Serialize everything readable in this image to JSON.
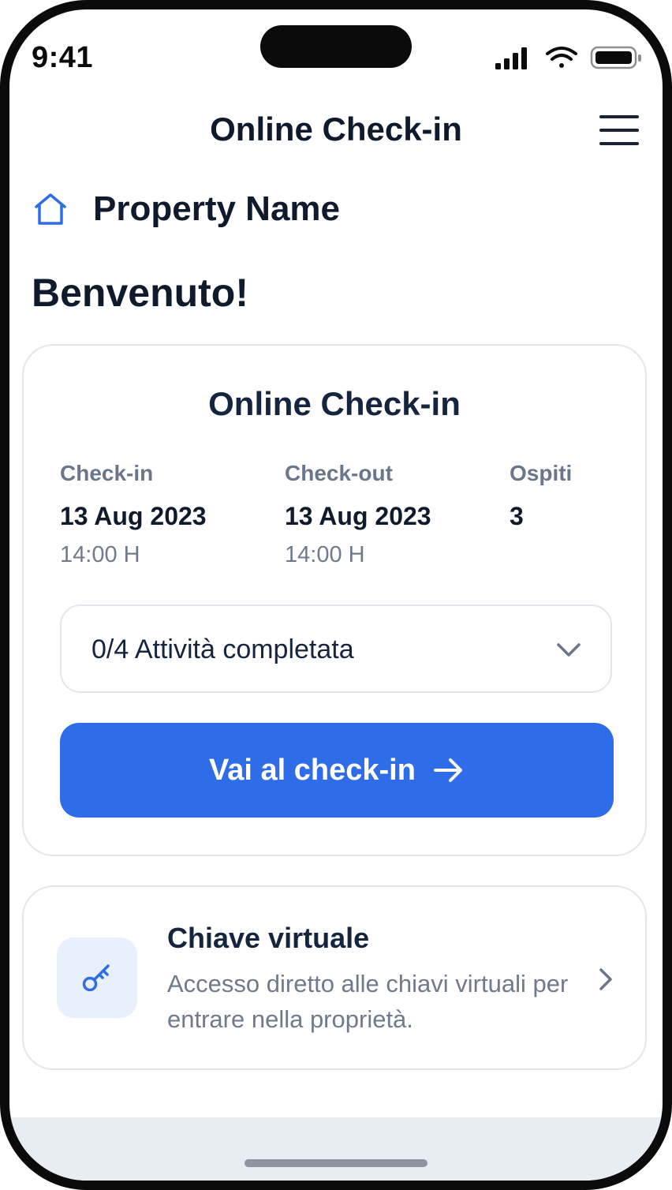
{
  "status_bar": {
    "time": "9:41"
  },
  "nav": {
    "title": "Online Check-in"
  },
  "property": {
    "name": "Property Name"
  },
  "greeting": "Benvenuto!",
  "checkin_card": {
    "title": "Online Check-in",
    "columns": [
      {
        "label": "Check-in",
        "date": "13 Aug 2023",
        "time": "14:00 H"
      },
      {
        "label": "Check-out",
        "date": "13 Aug 2023",
        "time": "14:00 H"
      },
      {
        "label": "Ospiti",
        "value": "3"
      }
    ],
    "tasks_dropdown": {
      "label": "0/4 Attività completata"
    },
    "cta": {
      "label": "Vai al check-in"
    }
  },
  "virtual_key_card": {
    "title": "Chiave virtuale",
    "description": "Accesso diretto alle chiavi virtuali per entrare nella proprietà."
  },
  "colors": {
    "accent": "#2f6de8",
    "text_primary": "#0f1b2d",
    "text_muted": "#6f7a8c",
    "key_tile_bg": "#e8f0fd"
  },
  "icons": [
    "signal-icon",
    "wifi-icon",
    "battery-icon",
    "menu-icon",
    "home-icon",
    "chevron-down-icon",
    "arrow-right-icon",
    "key-icon",
    "chevron-right-icon"
  ]
}
